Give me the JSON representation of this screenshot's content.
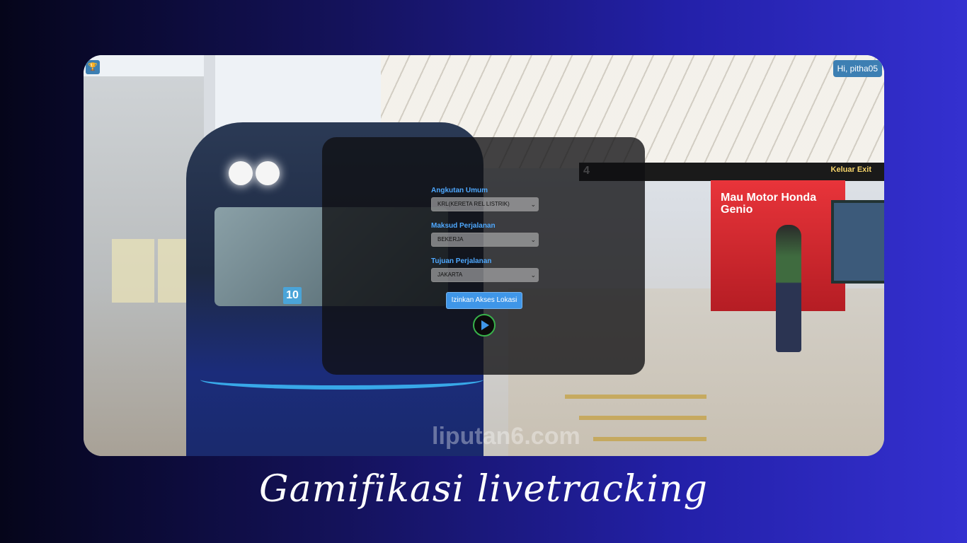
{
  "screen": {
    "photo": {
      "train_number": "10",
      "platform_number": "4",
      "exit_sign": "Keluar Exit",
      "ad_title": "Mau Motor Honda Genio",
      "watermark": "liputan6.com"
    },
    "trophy_icon": "trophy-icon",
    "greeting": "Hi, pitha05",
    "form": {
      "transport": {
        "label": "Angkutan Umum",
        "selected": "KRL(KERETA REL LISTRIK)"
      },
      "purpose": {
        "label": "Maksud Perjalanan",
        "selected": "BEKERJA"
      },
      "destination": {
        "label": "Tujuan Perjalanan",
        "selected": "JAKARTA"
      },
      "location_button": "Izinkan Akses Lokasi",
      "play_icon": "play-icon"
    }
  },
  "caption": "Gamifikasi livetracking",
  "colors": {
    "accent_blue": "#3f96e8",
    "label_blue": "#4ea8ff",
    "play_ring_green": "#38b24a",
    "badge_blue": "#3d7fb3"
  }
}
